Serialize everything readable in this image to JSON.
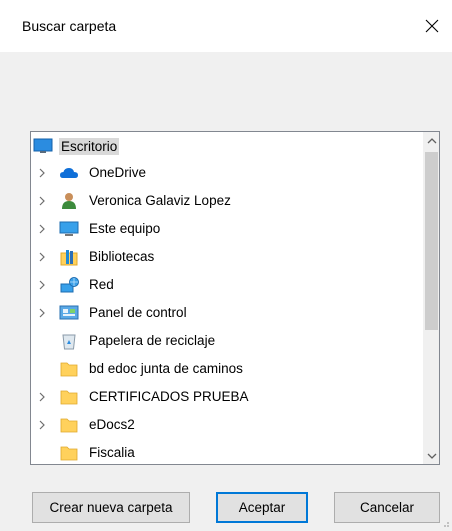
{
  "window": {
    "title": "Buscar carpeta"
  },
  "tree": {
    "root": {
      "label": "Escritorio",
      "icon": "desktop-icon"
    },
    "items": [
      {
        "label": "OneDrive",
        "icon": "cloud-icon",
        "expandable": true
      },
      {
        "label": "Veronica Galaviz Lopez",
        "icon": "user-icon",
        "expandable": true
      },
      {
        "label": "Este equipo",
        "icon": "computer-icon",
        "expandable": true
      },
      {
        "label": "Bibliotecas",
        "icon": "library-icon",
        "expandable": true
      },
      {
        "label": "Red",
        "icon": "network-icon",
        "expandable": true
      },
      {
        "label": "Panel de control",
        "icon": "control-panel-icon",
        "expandable": true
      },
      {
        "label": "Papelera de reciclaje",
        "icon": "recycle-bin-icon",
        "expandable": false
      },
      {
        "label": "bd edoc junta de caminos",
        "icon": "folder-icon",
        "expandable": false
      },
      {
        "label": "CERTIFICADOS PRUEBA",
        "icon": "folder-icon",
        "expandable": true
      },
      {
        "label": "eDocs2",
        "icon": "folder-icon",
        "expandable": true
      },
      {
        "label": "Fiscalia",
        "icon": "folder-icon",
        "expandable": false
      }
    ]
  },
  "buttons": {
    "new_folder": "Crear nueva carpeta",
    "accept": "Aceptar",
    "cancel": "Cancelar"
  },
  "colors": {
    "accent": "#0078d7",
    "folder": "#ffd15c",
    "selection": "#d9d9d9"
  }
}
